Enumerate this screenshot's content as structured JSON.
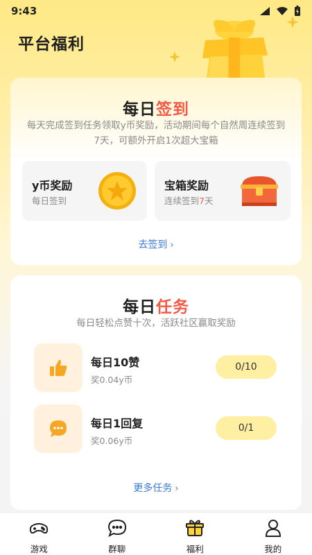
{
  "status": {
    "time": "9:43"
  },
  "header": {
    "title": "平台福利"
  },
  "signin": {
    "title_part1": "每日",
    "title_part2": "签到",
    "desc": "每天完成签到任务领取y币奖励，活动期间每个自然周连续签到7天，可额外开启1次超大宝箱",
    "rewards": [
      {
        "title": "y币奖励",
        "sub": "每日签到"
      },
      {
        "title": "宝箱奖励",
        "sub_prefix": "连续签到",
        "sub_highlight": "7",
        "sub_suffix": "天"
      }
    ],
    "link": "去签到"
  },
  "tasks": {
    "title_part1": "每日",
    "title_part2": "任务",
    "desc": "每日轻松点赞十次，活跃社区赢取奖励",
    "items": [
      {
        "name": "每日10赞",
        "reward": "奖0.04y币",
        "progress": "0/10",
        "icon": "thumbs-up-icon"
      },
      {
        "name": "每日1回复",
        "reward": "奖0.06y币",
        "progress": "0/1",
        "icon": "chat-bubble-icon"
      }
    ],
    "link": "更多任务"
  },
  "tabbar": {
    "items": [
      {
        "label": "游戏",
        "icon": "gamepad-icon"
      },
      {
        "label": "群聊",
        "icon": "chat-icon"
      },
      {
        "label": "福利",
        "icon": "gift-icon"
      },
      {
        "label": "我的",
        "icon": "profile-icon"
      }
    ],
    "active": 2
  },
  "colors": {
    "accent_red": "#F25A46",
    "link_blue": "#3A7BD5",
    "progress_bg": "#FFEFA3"
  }
}
